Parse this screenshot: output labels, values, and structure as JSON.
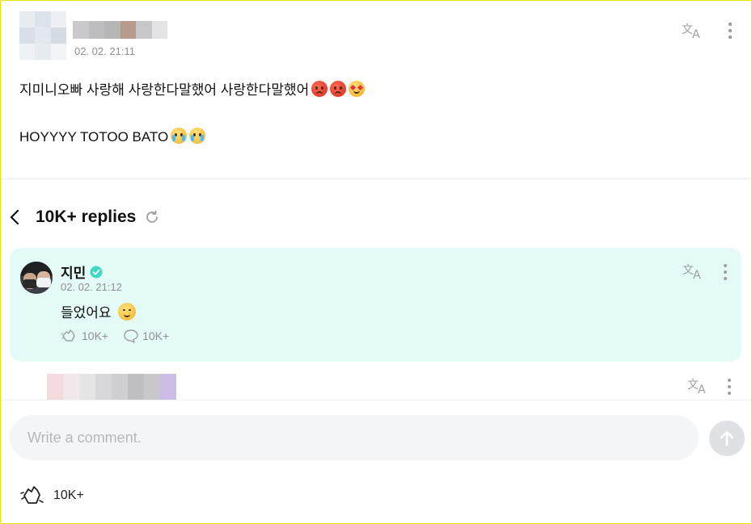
{
  "post": {
    "time": "02. 02. 21:11",
    "line1": "지미니오빠 사랑해 사랑한다말했어 사랑한다말했어",
    "line2": "HOYYYY TOTOO BATO",
    "line1_emojis": [
      "angry-face-emoji",
      "angry-face-emoji",
      "smiling-face-with-hearts-emoji"
    ],
    "line2_emojis": [
      "crying-face-emoji",
      "crying-face-emoji"
    ]
  },
  "replies": {
    "title": "10K+ replies"
  },
  "highlight_reply": {
    "author": "지민",
    "time": "02. 02. 21:12",
    "text": "들었어요",
    "likes": "10K+",
    "comments": "10K+"
  },
  "comment_box": {
    "placeholder": "Write a comment."
  },
  "footer": {
    "likes": "10K+"
  },
  "colors": {
    "reply_background": "#e3faf6",
    "verified": "#3dd9c6",
    "muted_text": "#8d9096"
  },
  "icons": {
    "translate": "translate-icon",
    "more": "more-vertical-icon",
    "back": "chevron-left-icon",
    "refresh": "refresh-icon",
    "verified": "verified-badge-icon",
    "like": "cheer-hands-icon",
    "comment": "comment-bubble-icon",
    "send": "arrow-up-icon"
  }
}
